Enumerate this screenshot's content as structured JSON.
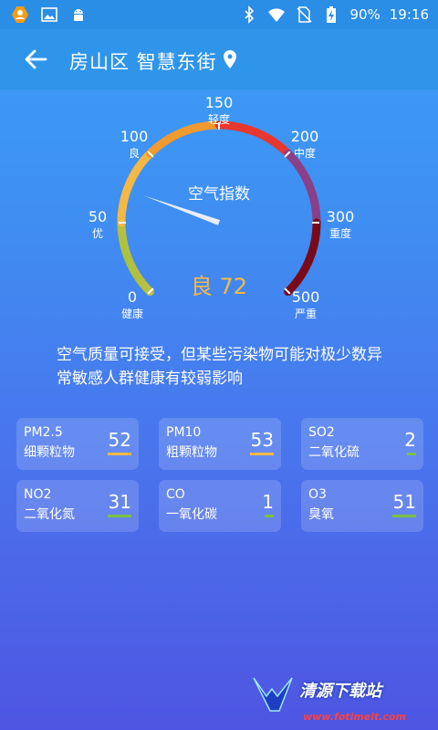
{
  "status_bar": {
    "battery": "90%",
    "time": "19:16",
    "icons_left": [
      "avatar-icon",
      "image-icon",
      "android-icon"
    ],
    "icons_right": [
      "bluetooth-icon",
      "wifi-icon",
      "no-sim-icon",
      "battery-charging-icon"
    ]
  },
  "header": {
    "title": "房山区 智慧东街"
  },
  "gauge": {
    "title": "空气指数",
    "value_label": "良 72",
    "aqi": 72,
    "max": 500,
    "ticks": [
      {
        "value": "0",
        "label": "健康"
      },
      {
        "value": "50",
        "label": "优"
      },
      {
        "value": "100",
        "label": "良"
      },
      {
        "value": "150",
        "label": "轻度"
      },
      {
        "value": "200",
        "label": "中度"
      },
      {
        "value": "300",
        "label": "重度"
      },
      {
        "value": "500",
        "label": "严重"
      }
    ]
  },
  "description": "空气质量可接受，但某些污染物可能对极少数异常敏感人群健康有较弱影响",
  "pollutants": [
    {
      "name": "PM2.5",
      "cn": "细颗粒物",
      "value": "52",
      "color": "#f5b845",
      "bar_fraction": 1.0
    },
    {
      "name": "PM10",
      "cn": "粗颗粒物",
      "value": "53",
      "color": "#f5b845",
      "bar_fraction": 1.0
    },
    {
      "name": "SO2",
      "cn": "二氧化硫",
      "value": "2",
      "color": "#7cc242",
      "bar_fraction": 0.4
    },
    {
      "name": "NO2",
      "cn": "二氧化氮",
      "value": "31",
      "color": "#7cc242",
      "bar_fraction": 1.0
    },
    {
      "name": "CO",
      "cn": "一氧化碳",
      "value": "1",
      "color": "#7cc242",
      "bar_fraction": 0.4
    },
    {
      "name": "O3",
      "cn": "臭氧",
      "value": "51",
      "color": "#7cc242",
      "bar_fraction": 1.0
    }
  ],
  "watermark": {
    "brand": "清源下载站",
    "url": "www.fotimeit.com"
  }
}
